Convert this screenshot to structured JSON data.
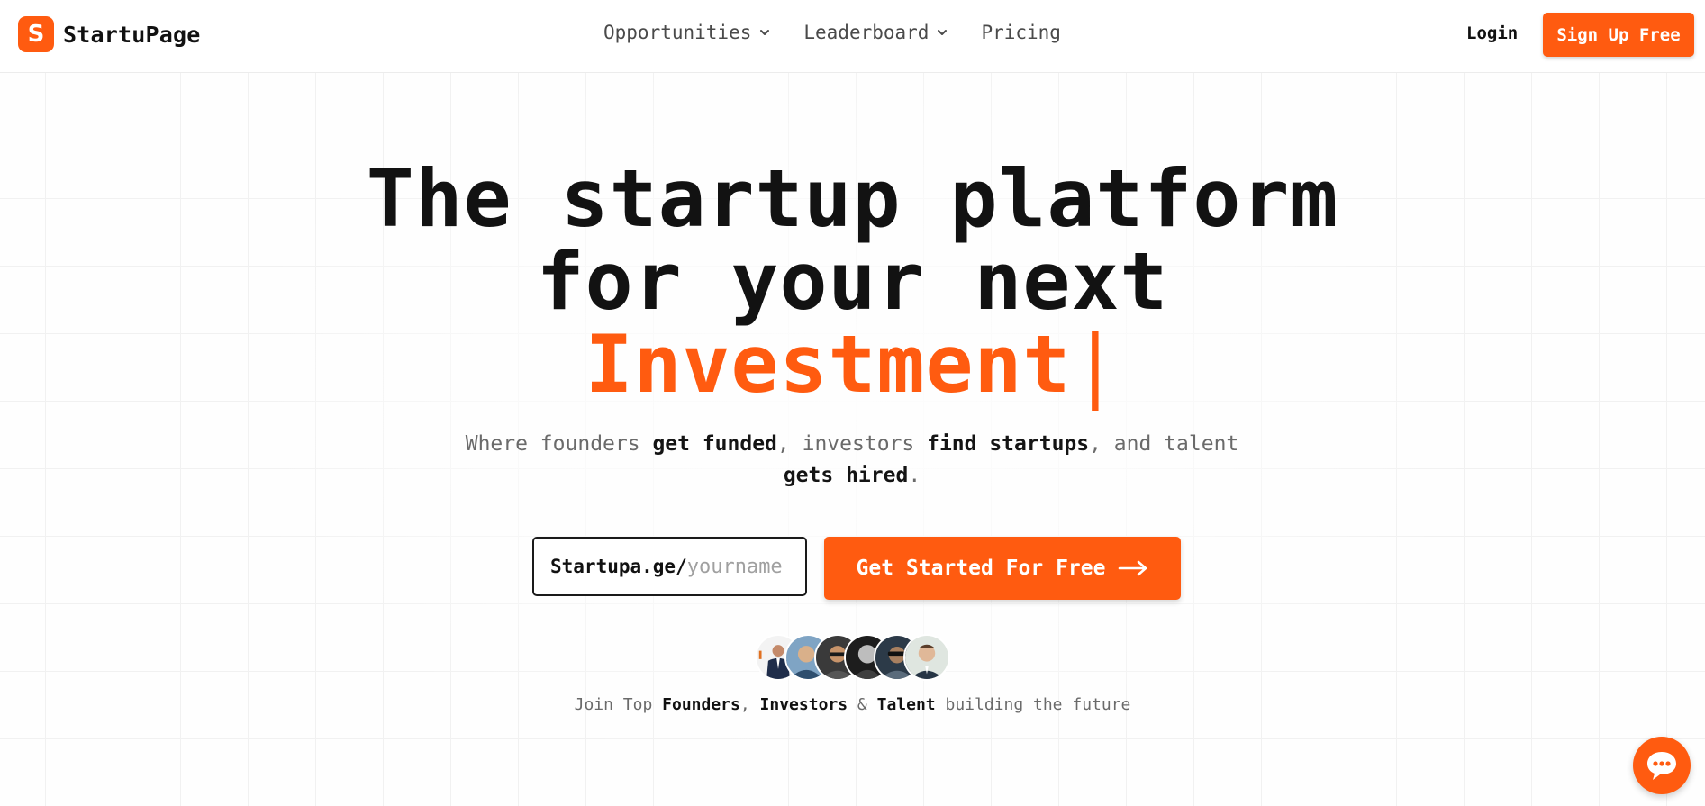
{
  "brand": {
    "name": "StartuPage",
    "logo_glyph": "S",
    "accent_color": "#ff5b10"
  },
  "nav": {
    "items": [
      {
        "label": "Opportunities",
        "has_dropdown": true
      },
      {
        "label": "Leaderboard",
        "has_dropdown": true
      },
      {
        "label": "Pricing",
        "has_dropdown": false
      }
    ],
    "login_label": "Login",
    "signup_label": "Sign Up Free"
  },
  "hero": {
    "title_line1": "The startup platform",
    "title_line2": "for your next",
    "title_rotating_word": "Investment",
    "cursor": "|",
    "subtitle": {
      "p1": "Where founders ",
      "b1": "get funded",
      "p2": ", investors ",
      "b2": "find startups",
      "p3": ", and talent ",
      "b3": "gets hired",
      "p4": "."
    }
  },
  "signup_form": {
    "url_prefix": "Startupa.ge/",
    "placeholder": "yourname",
    "value": "",
    "cta_label": "Get Started For Free",
    "cta_icon": "arrow-right-icon"
  },
  "social_proof": {
    "avatar_count": 6,
    "p1": "Join Top ",
    "b1": "Founders",
    "p2": ", ",
    "b2": "Investors",
    "p3": " & ",
    "b3": "Talent",
    "p4": " building the future"
  },
  "chat_widget": {
    "icon": "chat-bubble-icon"
  }
}
